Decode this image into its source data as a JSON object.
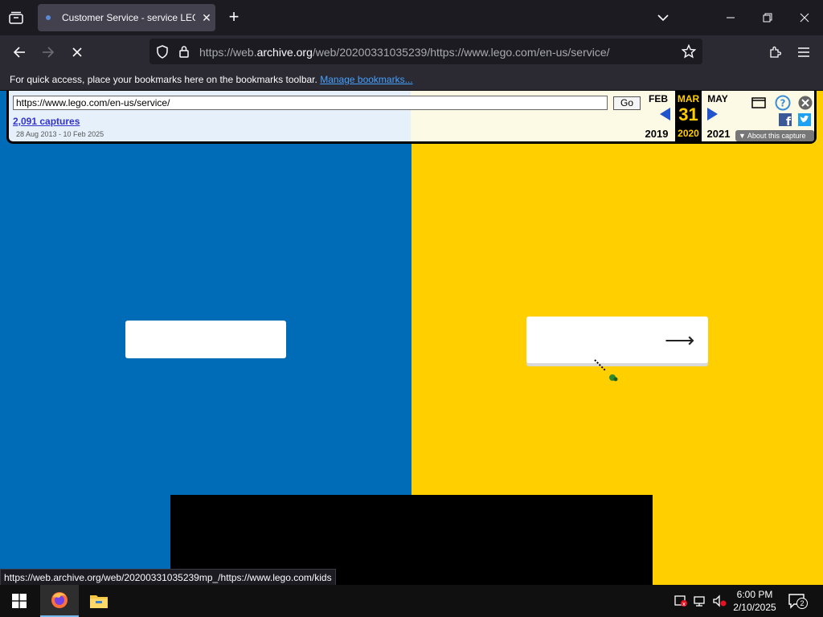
{
  "browser": {
    "tab": {
      "title": "Customer Service - service LEGO",
      "close_glyph": "✕"
    },
    "new_tab_glyph": "+",
    "url": {
      "prefix": "https://web.",
      "domain": "archive.org",
      "suffix": "/web/20200331035239/https://www.lego.com/en-us/service/"
    },
    "bookmarks_bar": {
      "message": "For quick access, place your bookmarks here on the bookmarks toolbar.",
      "link": "Manage bookmarks..."
    },
    "status_url": "https://web.archive.org/web/20200331035239mp_/https://www.lego.com/kids"
  },
  "wayback": {
    "url_value": "https://www.lego.com/en-us/service/",
    "go_label": "Go",
    "captures": "2,091 captures",
    "range": "28 Aug 2013 - 10 Feb 2025",
    "prev_month": "FEB",
    "cur_month": "MAR",
    "next_month": "MAY",
    "cur_day": "31",
    "prev_year": "2019",
    "cur_year": "2020",
    "next_year": "2021",
    "about": "About this capture"
  },
  "page": {
    "colors": {
      "left_panel": "#006cb7",
      "right_panel": "#ffcf00"
    },
    "right_card_arrow": "⟶"
  },
  "taskbar": {
    "time": "6:00 PM",
    "date": "2/10/2025",
    "notification_count": "2"
  }
}
